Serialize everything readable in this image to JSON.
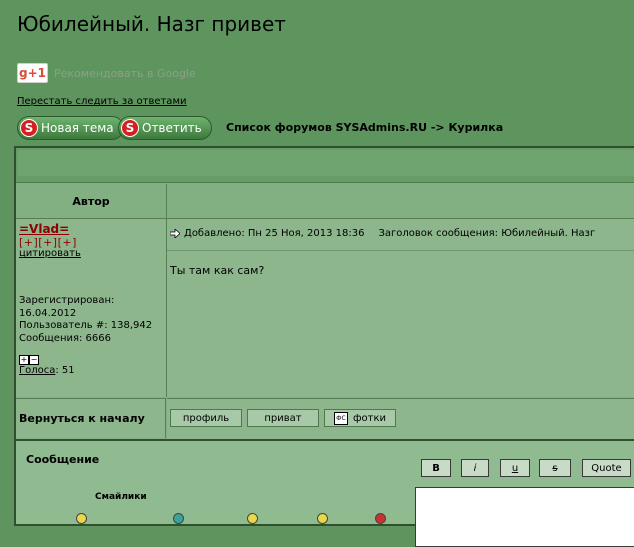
{
  "page": {
    "title": "Юбилейный. Назг привет",
    "gplus_label": "g+1",
    "gplus_text": "Рекомендовать в Google",
    "unsubscribe": "Перестать следить за ответами",
    "forum_path": "Список форумов SYSAdmins.RU -> Курилка"
  },
  "buttons": {
    "new_topic": "Новая тема",
    "reply": "Ответить",
    "s_icon": "S"
  },
  "table": {
    "author_header": "Автор"
  },
  "post": {
    "username": "=Vlad=",
    "plus_links": "[+][+][+]",
    "quote": "цитировать",
    "registered_label": "Зарегистрирован:",
    "registered_date": "16.04.2012",
    "user_number": "Пользователь #: 138,942",
    "messages": "Сообщения: 6666",
    "votes_label": "Голоса",
    "votes_count": ": 51",
    "meta_added": "Добавлено: Пн 25 Ноя, 2013 18:36",
    "meta_subject": "Заголовок сообщения: Юбилейный. Назг",
    "body": "Ты там как сам?",
    "vote_plus": "+",
    "vote_minus": "−"
  },
  "footer": {
    "back_to_top": "Вернуться к началу",
    "profile": "профиль",
    "private": "приват",
    "photos": "фотки",
    "photo_icon_text": "ФС"
  },
  "reply": {
    "label": "Сообщение",
    "smilies": "Смайлики",
    "bold": "B",
    "italic": "i",
    "underline": "u",
    "strike": "s",
    "quote": "Quote"
  },
  "colors": {
    "background": "#5e955e",
    "username": "#8b0000",
    "smiley_yellow": "#e8d84a",
    "smiley_teal": "#3aa39a",
    "smiley_red": "#cc3030"
  },
  "icons": [
    "gplus-icon",
    "s-icon",
    "arrow-icon",
    "photo-icon",
    "smiley-icon"
  ]
}
